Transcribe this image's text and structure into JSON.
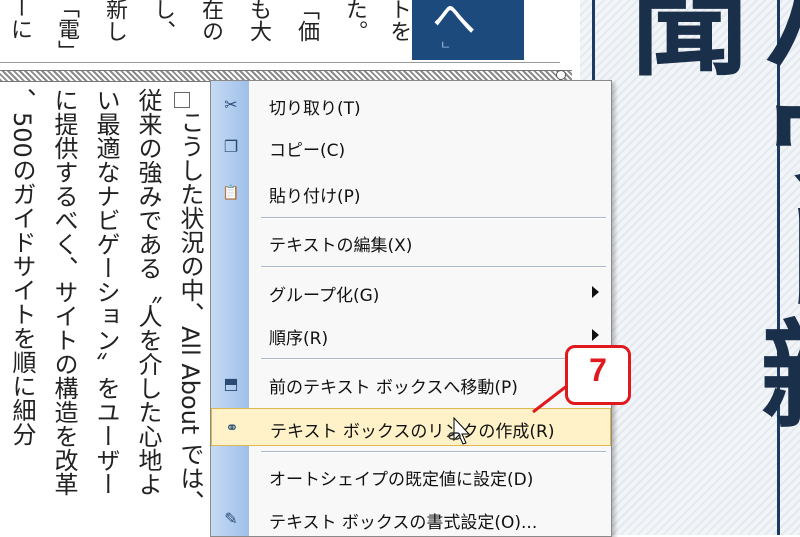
{
  "top_article": {
    "columns": [
      "「電」",
      "新し",
      "し、",
      "在の",
      "も大",
      "「価",
      "た。",
      "トを"
    ],
    "left_fragment": "ーに"
  },
  "blue_tab": {
    "glyph": "へ",
    "small": "ㄴ"
  },
  "body_text": {
    "columns": [
      "こうした状況の中、All About では、",
      "従来の強みである〝人を介した心地よ",
      "い最適なナビゲーション〟をユーザー",
      "に提供するべく、サイトの構造を改革",
      "、500のガイドサイトを順に細分"
    ]
  },
  "title_panel": {
    "text": "バウト新聞"
  },
  "menu": {
    "items": [
      {
        "label": "切り取り(T)",
        "icon": "scissors-icon",
        "glyph": "✂"
      },
      {
        "label": "コピー(C)",
        "icon": "copy-icon",
        "glyph": "❐"
      },
      {
        "label": "貼り付け(P)",
        "icon": "paste-icon",
        "glyph": "📋"
      },
      {
        "label": "テキストの編集(X)",
        "icon": "",
        "glyph": ""
      },
      {
        "label": "グループ化(G)",
        "icon": "",
        "glyph": ""
      },
      {
        "label": "順序(R)",
        "icon": "",
        "glyph": ""
      },
      {
        "label": "前のテキスト ボックスへ移動(P)",
        "icon": "prev-textbox-icon",
        "glyph": "⬒"
      },
      {
        "label": "テキスト ボックスのリンクの作成(R)",
        "icon": "link-icon",
        "glyph": "⚭"
      },
      {
        "label": "オートシェイプの既定値に設定(D)",
        "icon": "",
        "glyph": ""
      },
      {
        "label": "テキスト ボックスの書式設定(O)...",
        "icon": "format-textbox-icon",
        "glyph": "✎"
      }
    ]
  },
  "callout": {
    "number": "7"
  },
  "colors": {
    "accent": "#e0191f",
    "navy": "#1d4a7c",
    "highlight": "#fff2c8"
  }
}
